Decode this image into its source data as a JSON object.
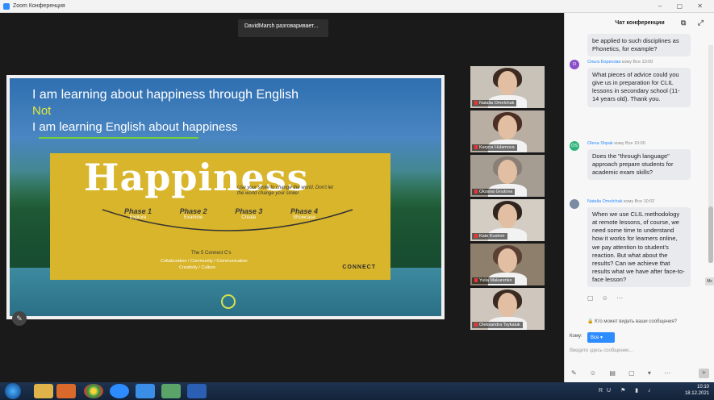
{
  "window": {
    "title": "Zoom Конференция"
  },
  "speaker_label": "DavidMarsh разговаривает...",
  "slide": {
    "line1": "I am learning about happiness through English",
    "line2": "Not",
    "line3": "I am learning English about happiness",
    "big_word": "Happiness",
    "tagline": "Use your smile to change the world. Don't let the world change your smile!",
    "phases": [
      {
        "title": "Phase 1",
        "sub": "Explore"
      },
      {
        "title": "Phase 2",
        "sub": "Examine"
      },
      {
        "title": "Phase 3",
        "sub": "Create"
      },
      {
        "title": "Phase 4",
        "sub": "Showcase"
      }
    ],
    "connect_cs": "The 5 Connect C's",
    "collab_line1": "Collaboration / Community / Communication",
    "collab_line2": "Creativity / Culture",
    "brand": "CONNECT"
  },
  "participants": [
    {
      "name": "Natalia Omelchak",
      "hair": "#3d2b22",
      "bg": "#c9c2b8"
    },
    {
      "name": "Karyna Hulamova",
      "hair": "#4b2f25",
      "bg": "#b9aea2"
    },
    {
      "name": "Oksana Gnutova",
      "hair": "#8a7e76",
      "bg": "#a59c92"
    },
    {
      "name": "Kate Kushnir",
      "hair": "#2f241e",
      "bg": "#d4cdc4"
    },
    {
      "name": "Yulia Makarenko",
      "hair": "#5a4034",
      "bg": "#8e7f6c"
    },
    {
      "name": "Oleksandra Tsykaluk",
      "hair": "#3a2a22",
      "bg": "#cfc7bd"
    }
  ],
  "chat": {
    "header": "Чат конференции",
    "messages": [
      {
        "meta_name": "",
        "meta_rest": "",
        "avatar_text": "",
        "avatar_color": "",
        "text": "be applied to such disciplines as Phonetics, for example?"
      },
      {
        "meta_name": "Ольга Борисова",
        "meta_rest": "кому Все 10:00",
        "avatar_text": "О",
        "avatar_color": "#8b4fc9",
        "text": "What pieces of advice could you give us in preparation for CLIL lessons in secondary school (11-14 years old). Thank you."
      },
      {
        "meta_name": "Olena Shpak",
        "meta_rest": "кому Все 10:00",
        "avatar_text": "OS",
        "avatar_color": "#2fb37a",
        "text": "Does the \"through language\" approach prepare students for academic exam skills?"
      },
      {
        "meta_name": "Natalia Omelchak",
        "meta_rest": "кому Все 10:02",
        "avatar_text": "",
        "avatar_color": "#7a8aa3",
        "text": "When we use CLIL methodology at remote lessons, of course, we need some time to understand how it works for learners online, we pay attention to student's reaction. But what about the results? Can we achieve that results what we have after face-to-face lesson?"
      }
    ],
    "mini_button": "Mc",
    "who_sees": "Кто может видеть ваши сообщения?",
    "to_label": "Кому:",
    "to_value": "Все",
    "input_placeholder": "Введите здесь сообщение..."
  },
  "taskbar": {
    "lang": "RU",
    "time": "10:10",
    "date": "18.12.2021"
  }
}
